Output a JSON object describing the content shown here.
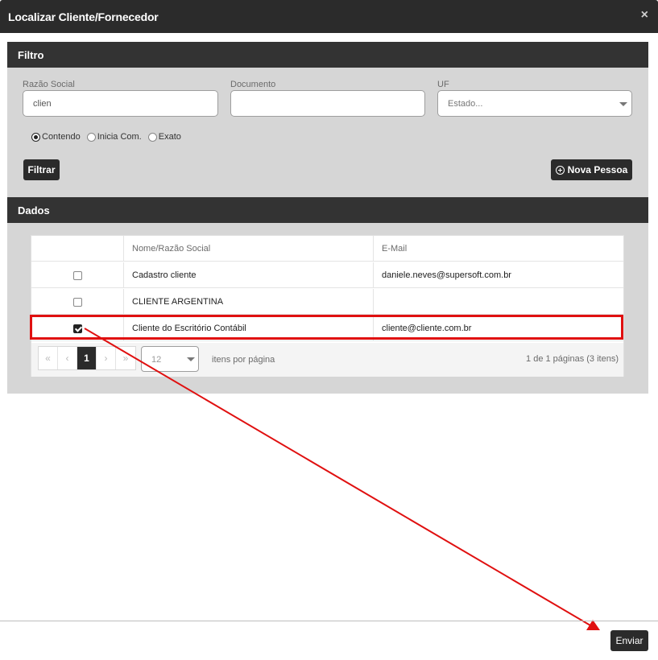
{
  "dialog": {
    "title": "Localizar Cliente/Fornecedor",
    "close_glyph": "×"
  },
  "filtro": {
    "header": "Filtro",
    "razao_social_label": "Razão Social",
    "razao_social_value": "clien",
    "documento_label": "Documento",
    "documento_value": "",
    "uf_label": "UF",
    "uf_placeholder": "Estado...",
    "match_options": [
      {
        "label": "Contendo",
        "checked": true
      },
      {
        "label": "Inicia Com.",
        "checked": false
      },
      {
        "label": "Exato",
        "checked": false
      }
    ],
    "filtrar_label": "Filtrar",
    "nova_pessoa_label": "Nova Pessoa",
    "nova_pessoa_icon": "plus-circle-icon"
  },
  "dados": {
    "header": "Dados",
    "columns": {
      "name": "Nome/Razão Social",
      "email": "E-Mail"
    },
    "rows": [
      {
        "name": "Cadastro cliente",
        "email": "daniele.neves@supersoft.com.br",
        "checked": false
      },
      {
        "name": "CLIENTE ARGENTINA",
        "email": "",
        "checked": false
      },
      {
        "name": "Cliente do Escritório Contábil",
        "email": "cliente@cliente.com.br",
        "checked": true
      }
    ],
    "pager": {
      "first": "«",
      "prev": "‹",
      "current_page": "1",
      "next": "›",
      "last": "»",
      "page_size": "12",
      "page_size_label": "itens por página",
      "info": "1 de 1 páginas (3 itens)"
    }
  },
  "footer": {
    "enviar_label": "Enviar"
  },
  "annotation": {
    "color": "#e01010"
  }
}
